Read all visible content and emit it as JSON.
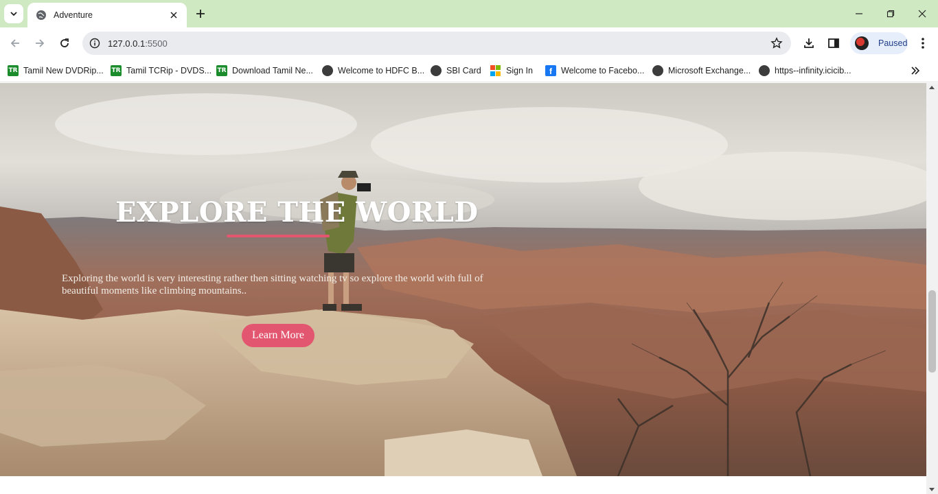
{
  "browser": {
    "tab_title": "Adventure",
    "url_host": "127.0.0.1",
    "url_port": ":5500",
    "profile_label": "Paused"
  },
  "bookmarks": [
    {
      "label": "Tamil New DVDRip...",
      "icon": "tr-icon"
    },
    {
      "label": "Tamil TCRip - DVDS...",
      "icon": "tr-icon"
    },
    {
      "label": "Download Tamil Ne...",
      "icon": "tr-icon"
    },
    {
      "label": "Welcome to HDFC B...",
      "icon": "globe-icon"
    },
    {
      "label": "SBI Card",
      "icon": "globe-icon"
    },
    {
      "label": "Sign In",
      "icon": "microsoft-icon"
    },
    {
      "label": "Welcome to Facebo...",
      "icon": "facebook-icon"
    },
    {
      "label": "Microsoft Exchange...",
      "icon": "globe-icon"
    },
    {
      "label": "https--infinity.icicib...",
      "icon": "globe-icon"
    }
  ],
  "hero": {
    "title": "EXPLORE THE WORLD",
    "text": "Exploring the world is very interesting rather then sitting watching tv so explore the world with full of beautiful moments like climbing mountains..",
    "button_label": "Learn More",
    "accent_color": "#e2566f"
  }
}
